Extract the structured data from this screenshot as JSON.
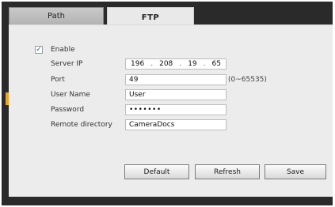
{
  "tabs": {
    "path_label": "Path",
    "ftp_label": "FTP"
  },
  "form": {
    "enable_label": "Enable",
    "enable_checked": true,
    "checkbox_mark": "✓",
    "server_ip_label": "Server IP",
    "server_ip": [
      "196",
      "208",
      "19",
      "65"
    ],
    "ip_separator": ".",
    "port_label": "Port",
    "port_value": "49",
    "port_hint": "(0~65535)",
    "username_label": "User Name",
    "username_value": "User",
    "password_label": "Password",
    "password_value": "•••••••",
    "remote_dir_label": "Remote directory",
    "remote_dir_value": "CameraDocs"
  },
  "buttons": {
    "default_label": "Default",
    "refresh_label": "Refresh",
    "save_label": "Save"
  }
}
